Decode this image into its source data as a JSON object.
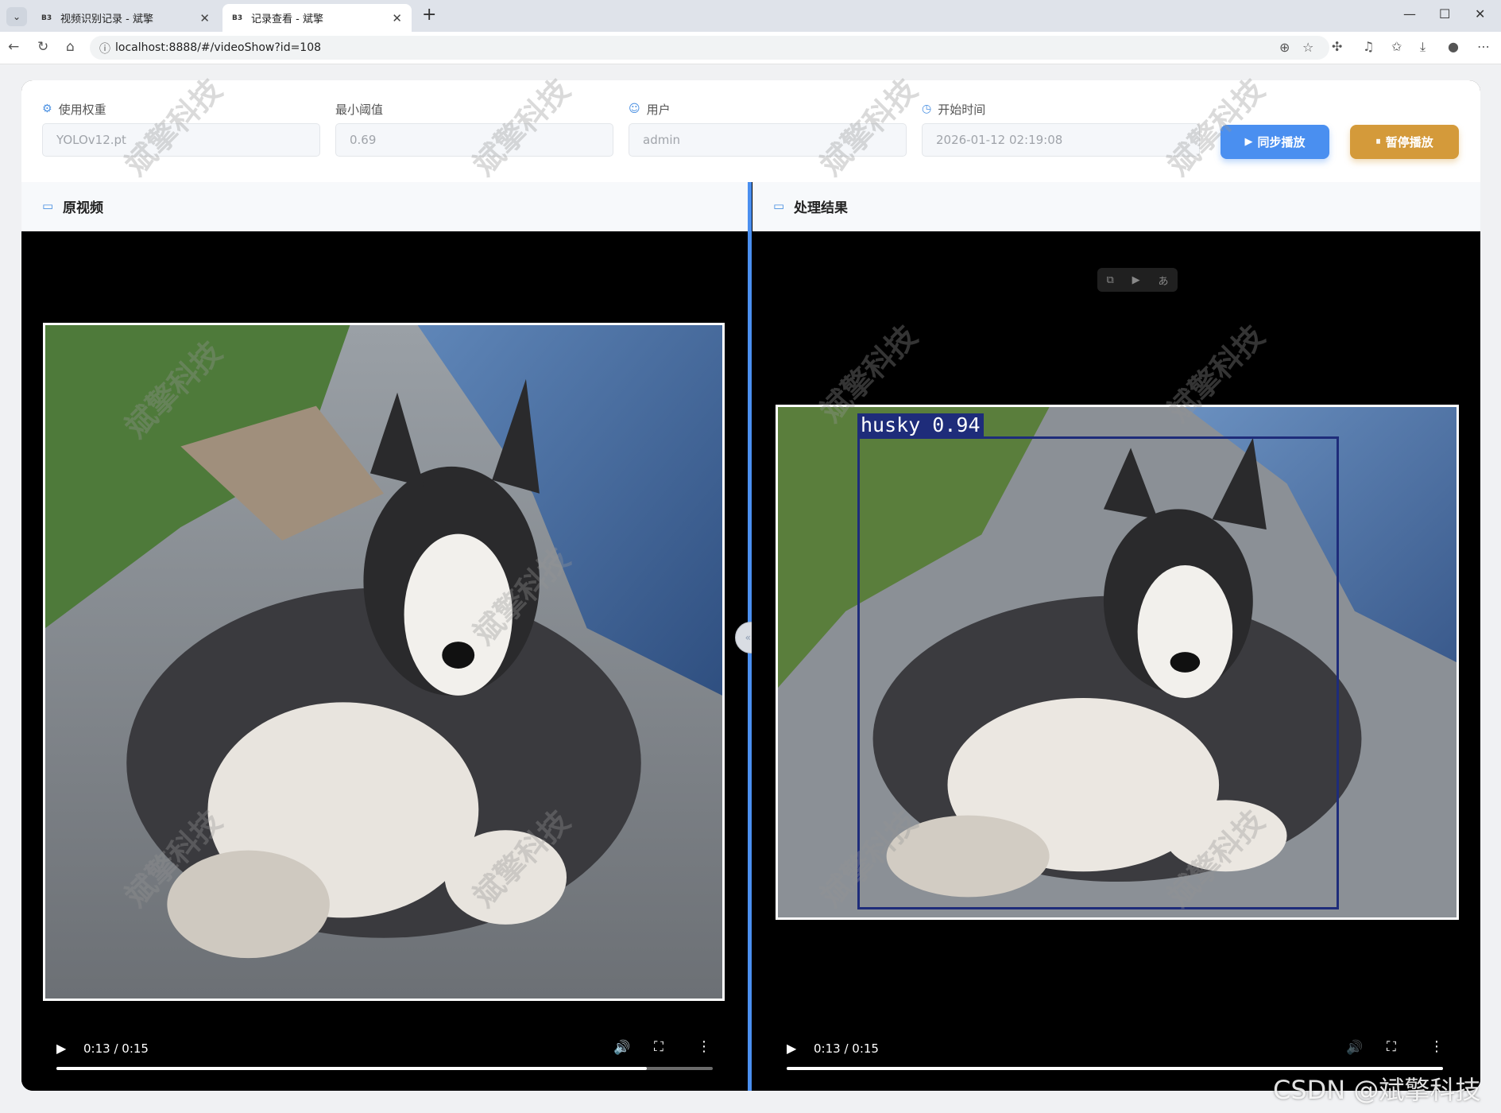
{
  "browser": {
    "tabs": [
      {
        "favicon": "B3",
        "title": "视频识别记录 - 斌擎",
        "close": "✕"
      },
      {
        "favicon": "B3",
        "title": "记录查看 - 斌擎",
        "close": "✕"
      }
    ],
    "new_tab": "+",
    "window_controls": {
      "minimize": "—",
      "maximize": "☐",
      "close": "✕"
    },
    "url": "localhost:8888/#/videoShow?id=108"
  },
  "form": {
    "weight": {
      "label": "使用权重",
      "value": "YOLOv12.pt"
    },
    "threshold": {
      "label": "最小阈值",
      "value": "0.69"
    },
    "user": {
      "label": "用户",
      "value": "admin"
    },
    "start_time": {
      "label": "开始时间",
      "value": "2026-01-12 02:19:08"
    },
    "sync_play_label": "同步播放",
    "pause_label": "暂停播放"
  },
  "panels": {
    "original_title": "原视频",
    "result_title": "处理结果"
  },
  "detection": {
    "label": "husky 0.94"
  },
  "videos": {
    "left": {
      "time": "0:13 / 0:15",
      "progress": 0.9
    },
    "right": {
      "time": "0:13 / 0:15",
      "progress": 1.0
    }
  },
  "watermark_text": "斌擎科技",
  "csdn_watermark": "CSDN @斌擎科技",
  "colors": {
    "accent": "#4a8ff0",
    "pause_button": "#d49a3a",
    "box": "#1e2c7a"
  }
}
